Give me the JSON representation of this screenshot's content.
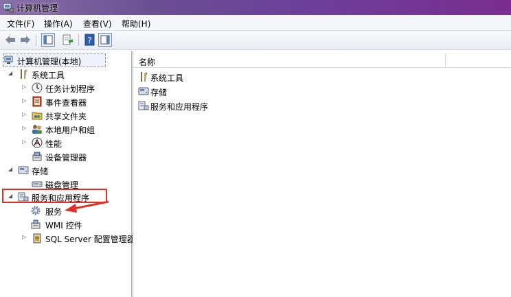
{
  "window": {
    "title": "计算机管理"
  },
  "menu": {
    "file": "文件(F)",
    "action": "操作(A)",
    "view": "查看(V)",
    "help": "帮助(H)"
  },
  "tree": {
    "root": "计算机管理(本地)",
    "system_tools": "系统工具",
    "task_scheduler": "任务计划程序",
    "event_viewer": "事件查看器",
    "shared_folders": "共享文件夹",
    "local_users": "本地用户和组",
    "performance": "性能",
    "device_manager": "设备管理器",
    "storage": "存储",
    "disk_management": "磁盘管理",
    "services_apps": "服务和应用程序",
    "services": "服务",
    "wmi": "WMI 控件",
    "sql_server": "SQL Server 配置管理器"
  },
  "list": {
    "column_name": "名称",
    "items": [
      "系统工具",
      "存储",
      "服务和应用程序"
    ]
  },
  "annotation_color": "#e0302b"
}
